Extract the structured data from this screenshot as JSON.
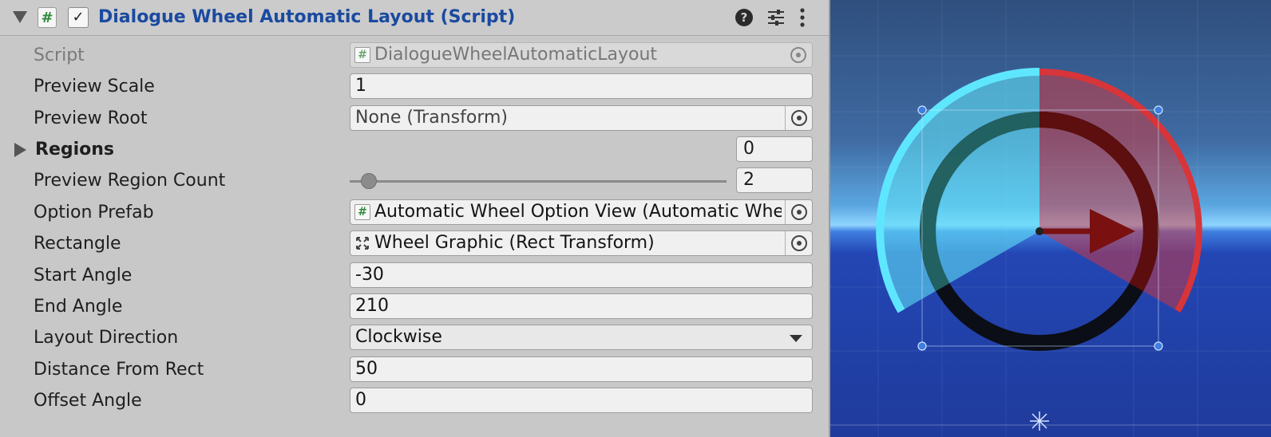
{
  "header": {
    "title": "Dialogue Wheel Automatic Layout (Script)",
    "component_icon": "#",
    "enabled": true,
    "icons": [
      "foldout-arrow-icon",
      "script-icon",
      "help-icon",
      "presets-icon",
      "more-options-icon"
    ]
  },
  "properties": {
    "script": {
      "label": "Script",
      "value": "DialogueWheelAutomaticLayout"
    },
    "preview_scale": {
      "label": "Preview Scale",
      "value": "1"
    },
    "preview_root": {
      "label": "Preview Root",
      "value": "None (Transform)"
    },
    "regions": {
      "label": "Regions",
      "count": "0"
    },
    "preview_region_count": {
      "label": "Preview Region Count",
      "value": "2",
      "slider_fraction": 0.05
    },
    "option_prefab": {
      "label": "Option Prefab",
      "value": "Automatic Wheel Option View (Automatic Whe"
    },
    "rectangle": {
      "label": "Rectangle",
      "value": "Wheel Graphic (Rect Transform)"
    },
    "start_angle": {
      "label": "Start Angle",
      "value": "-30"
    },
    "end_angle": {
      "label": "End Angle",
      "value": "210"
    },
    "layout_direction": {
      "label": "Layout Direction",
      "value": "Clockwise"
    },
    "distance_from_rect": {
      "label": "Distance From Rect",
      "value": "50"
    },
    "offset_angle": {
      "label": "Offset Angle",
      "value": "0"
    }
  },
  "scene": {
    "colors": {
      "sky_top": "#2f4f7e",
      "horizon": "#8fd4ff",
      "ground": "#1f3b9c",
      "region_cyan": "#5fe0f5",
      "region_red": "#d8353a",
      "ring": "#0a0a0a",
      "arrow": "#7a1010",
      "handle": "#3d7fe0"
    }
  }
}
